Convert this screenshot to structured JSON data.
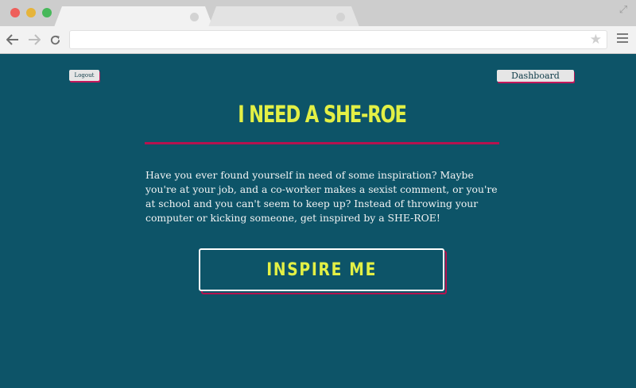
{
  "browser": {
    "url": "",
    "tabs": [
      {
        "title": ""
      },
      {
        "title": ""
      }
    ]
  },
  "header": {
    "logout_label": "Logout",
    "dashboard_label": "Dashboard"
  },
  "main": {
    "title": "I NEED A SHE-ROE",
    "intro": "Have you ever found yourself in need of some inspiration? Maybe you're at your job, and a co-worker makes a sexist comment, or you're at school and you can't seem to keep up? Instead of throwing your computer or kicking someone, get inspired by a SHE-ROE!",
    "cta_label": "INSPIRE ME"
  },
  "colors": {
    "background": "#0d5468",
    "accent_yellow": "#e3f045",
    "accent_magenta": "#b5134f"
  },
  "icons": [
    "back-arrow-icon",
    "forward-arrow-icon",
    "reload-icon",
    "star-icon",
    "menu-icon",
    "expand-icon"
  ]
}
